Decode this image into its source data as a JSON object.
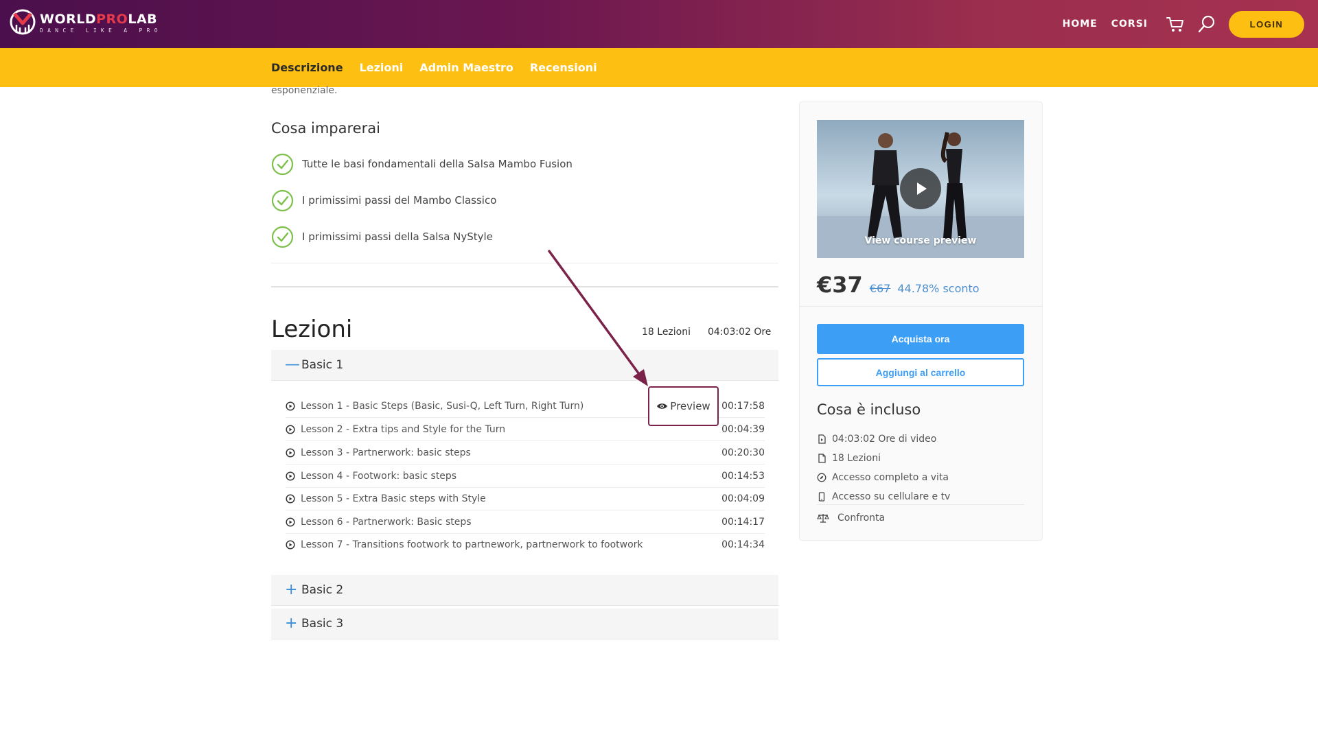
{
  "header": {
    "logo_title_a": "WORLD",
    "logo_title_b": "PRO",
    "logo_title_c": "LAB",
    "logo_tagline": "DANCE LIKE A PRO",
    "nav_home": "HOME",
    "nav_corsi": "CORSI",
    "login_label": "LOGIN",
    "icons": [
      "cart-icon",
      "search-icon"
    ]
  },
  "tabs": [
    {
      "label": "Descrizione",
      "active": true
    },
    {
      "label": "Lezioni",
      "active": false
    },
    {
      "label": "Admin Maestro",
      "active": false
    },
    {
      "label": "Recensioni",
      "active": false
    }
  ],
  "description": {
    "tail_text": "esponenziale."
  },
  "learn": {
    "title": "Cosa imparerai",
    "items": [
      "Tutte le basi fondamentali della Salsa Mambo Fusion",
      "I primissimi passi del Mambo Classico",
      "I primissimi passi della Salsa NyStyle"
    ]
  },
  "lessons": {
    "title": "Lezioni",
    "count_label": "18 Lezioni",
    "duration_label": "04:03:02 Ore",
    "sections": [
      {
        "name": "Basic 1",
        "expanded": true,
        "lessons": [
          {
            "title": "Lesson 1 - Basic Steps (Basic, Susi-Q, Left Turn, Right Turn)",
            "duration": "00:17:58",
            "preview": true
          },
          {
            "title": "Lesson 2 - Extra tips and Style for the Turn",
            "duration": "00:04:39"
          },
          {
            "title": "Lesson 3 - Partnerwork: basic steps",
            "duration": "00:20:30"
          },
          {
            "title": "Lesson 4 - Footwork: basic steps",
            "duration": "00:14:53"
          },
          {
            "title": "Lesson 5 - Extra Basic steps with Style",
            "duration": "00:04:09"
          },
          {
            "title": "Lesson 6 - Partnerwork: Basic steps",
            "duration": "00:14:17"
          },
          {
            "title": "Lesson 7 - Transitions footwork to partnework, partnerwork to footwork",
            "duration": "00:14:34"
          }
        ]
      },
      {
        "name": "Basic 2",
        "expanded": false
      },
      {
        "name": "Basic 3",
        "expanded": false
      }
    ],
    "preview_label": "Preview"
  },
  "sidebar": {
    "preview_label": "View course preview",
    "price": "€37",
    "old_price": "€67",
    "discount": "44.78% sconto",
    "buy_label": "Acquista ora",
    "cart_label": "Aggiungi al carrello",
    "included_title": "Cosa è incluso",
    "included": [
      {
        "icon": "video-file-icon",
        "text": "04:03:02 Ore di video"
      },
      {
        "icon": "file-icon",
        "text": "18 Lezioni"
      },
      {
        "icon": "compass-icon",
        "text": "Accesso completo a vita"
      },
      {
        "icon": "mobile-icon",
        "text": "Accesso su cellulare e tv"
      }
    ],
    "compare_label": "Confronta",
    "compare_icon": "scale-icon"
  },
  "colors": {
    "header_gradient_start": "#4a0f4c",
    "header_gradient_end": "#a63150",
    "accent_yellow": "#fdbf11",
    "primary_blue": "#3d9ef5",
    "check_green": "#7cc04b",
    "annotation_maroon": "#7a2249"
  }
}
